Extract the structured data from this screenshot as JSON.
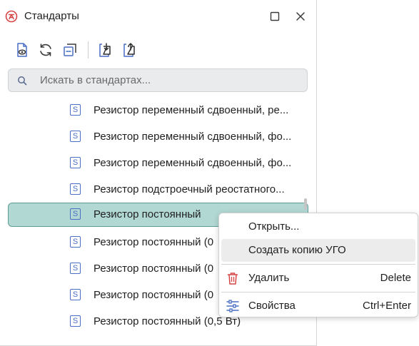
{
  "window": {
    "title": "Стандарты",
    "colors": {
      "accent": "#b2d8d4",
      "accent_border": "#5f9c96",
      "icon_blue": "#4a6fc4",
      "danger": "#d64545"
    }
  },
  "toolbar": {
    "buttons": [
      {
        "icon": "document-view-icon"
      },
      {
        "icon": "refresh-icon"
      },
      {
        "icon": "collapse-all-icon"
      },
      {
        "icon": "import-icon"
      },
      {
        "icon": "export-icon"
      }
    ]
  },
  "search": {
    "placeholder": "Искать в стандартах..."
  },
  "list": {
    "badge": "S",
    "items": [
      {
        "label": "Резистор переменный сдвоенный, ре..."
      },
      {
        "label": "Резистор переменный сдвоенный, фо..."
      },
      {
        "label": "Резистор переменный сдвоенный, фо..."
      },
      {
        "label": "Резистор подстроечный реостатного..."
      },
      {
        "label": "Резистор постоянный",
        "selected": true
      },
      {
        "label": "Резистор постоянный (0"
      },
      {
        "label": "Резистор постоянный (0"
      },
      {
        "label": "Резистор постоянный (0"
      },
      {
        "label": "Резистор постоянный (0,5 Вт)"
      }
    ]
  },
  "context_menu": {
    "items": [
      {
        "label": "Открыть...",
        "shortcut": ""
      },
      {
        "label": "Создать копию УГО",
        "shortcut": ""
      },
      {
        "label": "Удалить",
        "shortcut": "Delete",
        "icon": "trash-icon"
      },
      {
        "label": "Свойства",
        "shortcut": "Ctrl+Enter",
        "icon": "sliders-icon"
      }
    ]
  }
}
